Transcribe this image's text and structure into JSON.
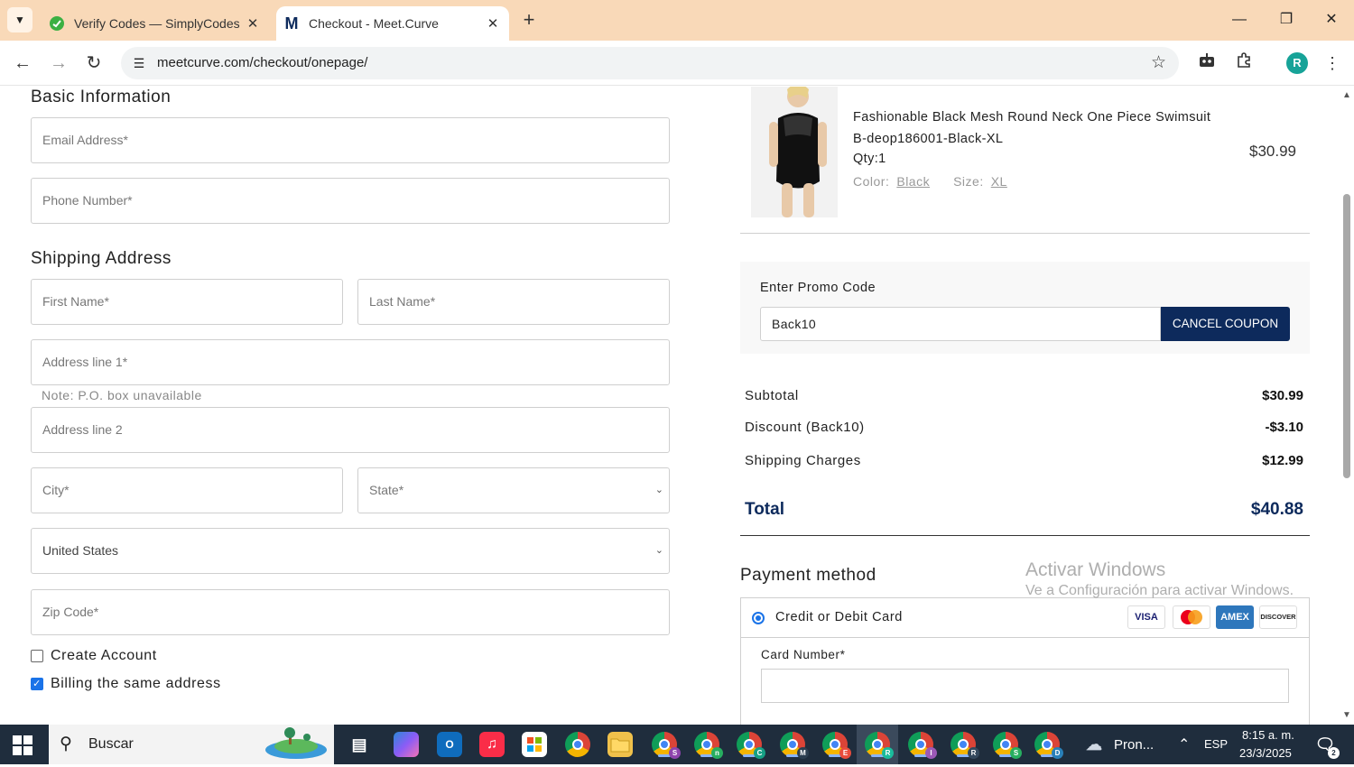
{
  "browser": {
    "tabs": [
      {
        "title": "Verify Codes — SimplyCodes",
        "favicon": "simplycodes-icon",
        "active": false
      },
      {
        "title": "Checkout - Meet.Curve",
        "favicon": "meetcurve-m-icon",
        "active": true
      }
    ],
    "url": "meetcurve.com/checkout/onepage/",
    "profile_initial": "R"
  },
  "form": {
    "basic_info_title": "Basic Information",
    "email_placeholder": "Email Address*",
    "phone_placeholder": "Phone Number*",
    "shipping_title": "Shipping Address",
    "first_name_placeholder": "First Name*",
    "last_name_placeholder": "Last Name*",
    "address1_placeholder": "Address line 1*",
    "address_note": "Note: P.O. box unavailable",
    "address2_placeholder": "Address line 2",
    "city_placeholder": "City*",
    "state_placeholder": "State*",
    "country_value": "United States",
    "zip_placeholder": "Zip Code*",
    "create_account_label": "Create Account",
    "create_account_checked": false,
    "billing_same_label": "Billing the same address",
    "billing_same_checked": true
  },
  "order": {
    "product_name_line1": "Fashionable Black Mesh Round Neck One Piece Swimsuit",
    "product_name_line2": "B-deop186001-Black-XL",
    "qty": "Qty:1",
    "color_label": "Color:",
    "color_value": "Black",
    "size_label": "Size:",
    "size_value": "XL",
    "price": "$30.99"
  },
  "promo": {
    "label": "Enter Promo Code",
    "value": "Back10",
    "button": "CANCEL COUPON"
  },
  "summary": {
    "subtotal_label": "Subtotal",
    "subtotal_value": "$30.99",
    "discount_label": "Discount (Back10)",
    "discount_value": "-$3.10",
    "shipping_label": "Shipping Charges",
    "shipping_value": "$12.99",
    "total_label": "Total",
    "total_value": "$40.88"
  },
  "payment": {
    "title": "Payment method",
    "option_label": "Credit or Debit Card",
    "card_logos": [
      "VISA",
      "mastercard",
      "AMEX",
      "DISCOVER"
    ],
    "card_number_label": "Card Number*"
  },
  "watermark": {
    "line1": "Activar Windows",
    "line2": "Ve a Configuración para activar Windows."
  },
  "taskbar": {
    "search_text": "Buscar",
    "pinned_label": "Pron...",
    "language": "ESP",
    "time": "8:15 a. m.",
    "date": "23/3/2025",
    "notifications": "2",
    "chrome_profiles": [
      "S",
      "n",
      "C",
      "M",
      "E",
      "R",
      "I",
      "R",
      "S",
      "D"
    ]
  },
  "colors": {
    "tabbar_bg": "#f9d9b8",
    "primary_navy": "#0d2a5c",
    "checkbox_blue": "#1a73e8",
    "taskbar_bg": "#1f2d3d"
  }
}
